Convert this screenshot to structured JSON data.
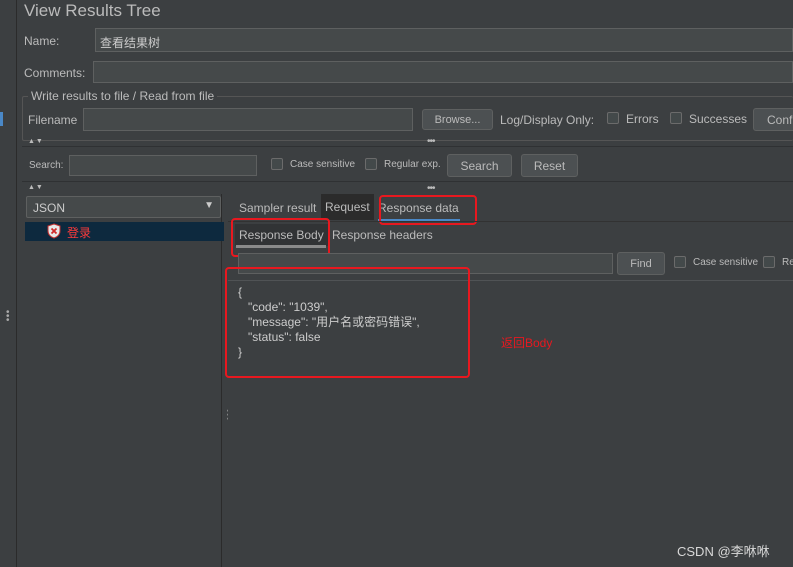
{
  "window": {
    "title": "View Results Tree"
  },
  "form": {
    "name_label": "Name:",
    "name_value": "查看结果树",
    "comments_label": "Comments:",
    "comments_value": ""
  },
  "file_section": {
    "legend": "Write results to file / Read from file",
    "filename_label": "Filename",
    "filename_value": "",
    "browse_label": "Browse...",
    "log_display_label": "Log/Display Only:",
    "errors_label": "Errors",
    "successes_label": "Successes",
    "configure_label": "Configure"
  },
  "search": {
    "label": "Search:",
    "value": "",
    "case_sensitive_label": "Case sensitive",
    "regex_label": "Regular exp.",
    "search_button": "Search",
    "reset_button": "Reset"
  },
  "renderer": {
    "selected": "JSON"
  },
  "tree": {
    "items": [
      {
        "label": "登录",
        "status": "error"
      }
    ]
  },
  "result_tabs": [
    "Sampler result",
    "Request",
    "Response data"
  ],
  "response_tabs": [
    "Response Body",
    "Response headers"
  ],
  "find": {
    "value": "",
    "find_button": "Find",
    "case_sensitive_label": "Case sensitive",
    "regex_label": "Regular exp."
  },
  "response_body": {
    "lines": [
      "{",
      "   \"code\": \"1039\",",
      "   \"message\": \"用户名或密码错误\",",
      "   \"status\": false",
      "}"
    ]
  },
  "annotation": {
    "text": "返回Body",
    "color": "#e8181f"
  },
  "watermark": {
    "text": "CSDN @李咻咻"
  },
  "colors": {
    "background": "#3c3f41",
    "highlight_red": "#e8181f",
    "tab_underline": "#4a88c7"
  }
}
